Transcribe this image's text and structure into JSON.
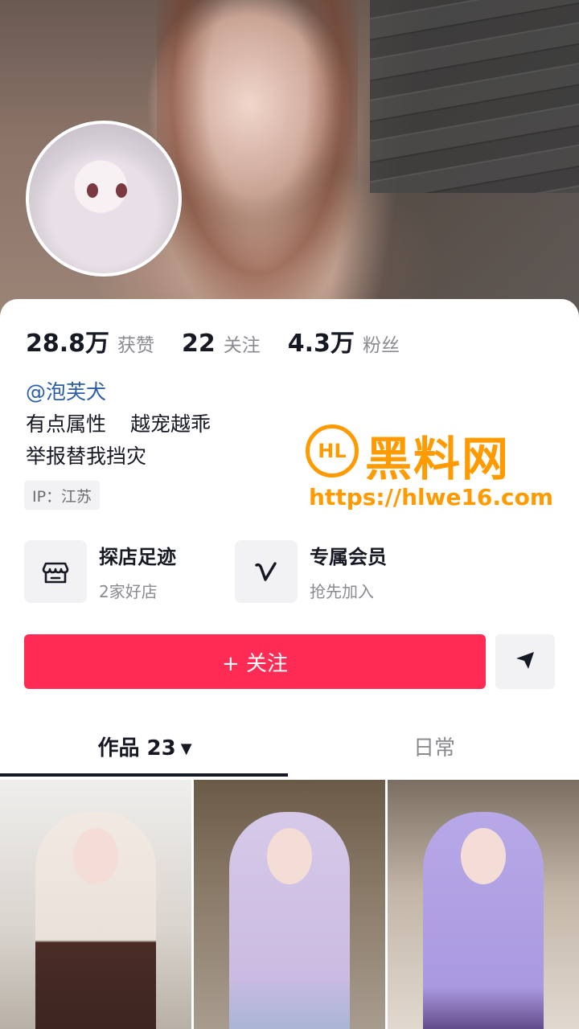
{
  "profile": {
    "stats": [
      {
        "value": "28.8万",
        "label": "获赞"
      },
      {
        "value": "22",
        "label": "关注"
      },
      {
        "value": "4.3万",
        "label": "粉丝"
      }
    ],
    "handle": "@泡芙犬",
    "bio_line1_a": "有点属性",
    "bio_line1_b": "越宠越乖",
    "bio_line2": "举报替我挡灾",
    "ip": "IP：江苏"
  },
  "features": [
    {
      "title": "探店足迹",
      "subtitle": "2家好店",
      "icon": "shop-icon"
    },
    {
      "title": "专属会员",
      "subtitle": "抢先加入",
      "icon": "vip-v-icon"
    }
  ],
  "actions": {
    "follow_label": "+ 关注",
    "share_icon": "send-icon"
  },
  "tabs": {
    "works_label": "作品 23",
    "works_caret": "▼",
    "daily_label": "日常"
  },
  "watermark": {
    "logo_text": "HL",
    "name": "黑料网",
    "url": "https://hlwe16.com"
  },
  "colors": {
    "follow_button": "#fe2c55",
    "handle_link": "#2c5ea8",
    "watermark": "#ff9a00"
  }
}
